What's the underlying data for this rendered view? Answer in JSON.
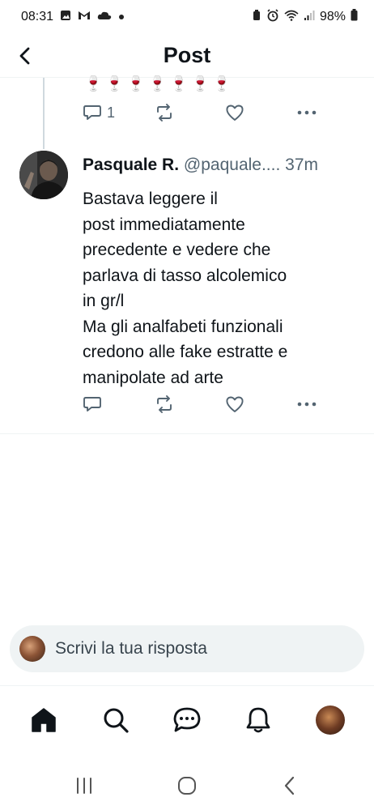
{
  "status_bar": {
    "time": "08:31",
    "battery": "98%"
  },
  "header": {
    "title": "Post"
  },
  "prev_post": {
    "emoji": "🍷🍷🍷🍷🍷🍷🍷",
    "reply_count": "1"
  },
  "reply_post": {
    "author_name": "Pasquale R.",
    "handle": "@paquale....",
    "time": "37m",
    "text": "Bastava leggere il\npost immediatamente\nprecedente e vedere che\nparlava di tasso alcolemico\nin gr/l\nMa gli analfabeti funzionali\ncredono alle fake estratte e\nmanipolate ad arte"
  },
  "reply_bar": {
    "placeholder": "Scrivi la tua risposta"
  },
  "icons": {
    "back": "back-arrow-icon",
    "reply": "speech-bubble-icon",
    "retweet": "repost-icon",
    "like": "heart-icon",
    "more": "more-dots-icon",
    "home": "home-icon",
    "search": "search-icon",
    "messages": "chat-icon",
    "notifications": "bell-icon"
  },
  "colors": {
    "icon_gray": "#536471",
    "text_dark": "#0f1419"
  }
}
